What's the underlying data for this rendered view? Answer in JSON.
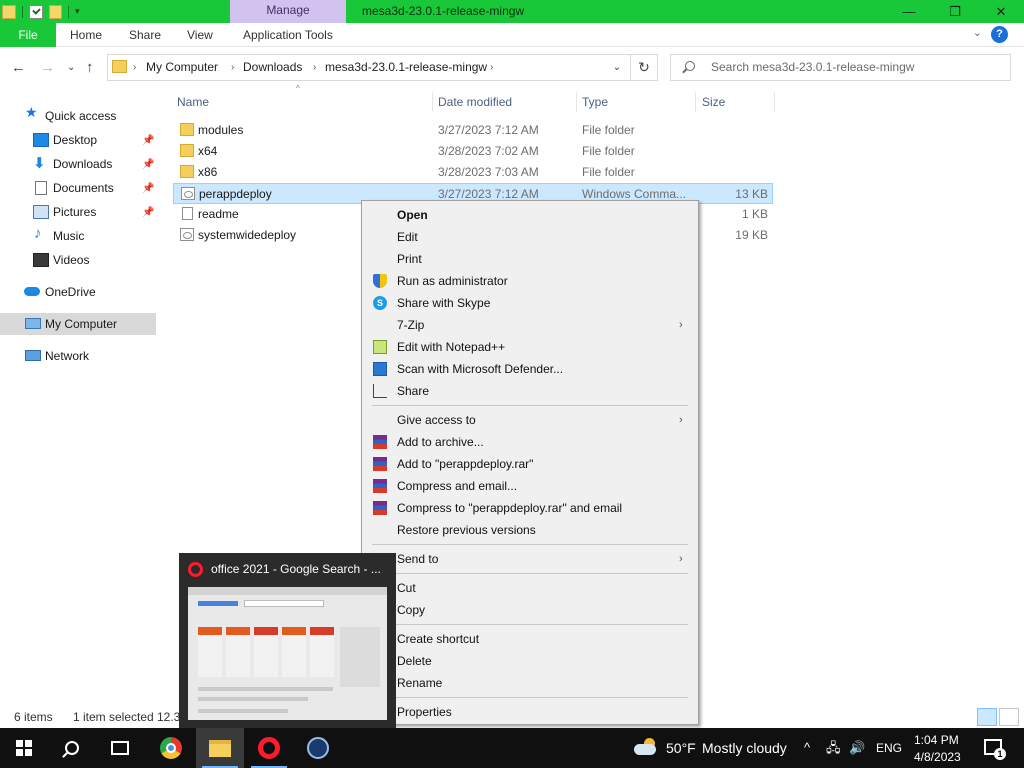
{
  "titlebar": {
    "manage_tab": "Manage",
    "window_title": "mesa3d-23.0.1-release-mingw",
    "controls": [
      "—",
      "❐",
      "✕"
    ]
  },
  "ribbon": {
    "tabs": [
      "File",
      "Home",
      "Share",
      "View",
      "Application Tools"
    ],
    "help": "?",
    "expand": "⌄"
  },
  "nav": {
    "back": "←",
    "forward": "→",
    "recent": "⌄",
    "up": "↑",
    "breadcrumb": [
      "My Computer",
      "Downloads",
      "mesa3d-23.0.1-release-mingw"
    ],
    "separator": "›",
    "dropdown": "⌄",
    "refresh": "↻",
    "search_placeholder": "Search mesa3d-23.0.1-release-mingw"
  },
  "sidebar": {
    "items": [
      {
        "label": "Quick access",
        "icon": "star-icon",
        "pinned": false
      },
      {
        "label": "Desktop",
        "icon": "desktop-icon",
        "pinned": true
      },
      {
        "label": "Downloads",
        "icon": "download-icon",
        "pinned": true
      },
      {
        "label": "Documents",
        "icon": "documents-icon",
        "pinned": true
      },
      {
        "label": "Pictures",
        "icon": "pictures-icon",
        "pinned": true
      },
      {
        "label": "Music",
        "icon": "music-icon",
        "pinned": false
      },
      {
        "label": "Videos",
        "icon": "videos-icon",
        "pinned": false
      },
      {
        "label": "OneDrive",
        "icon": "cloud-icon",
        "pinned": false
      },
      {
        "label": "My Computer",
        "icon": "computer-icon",
        "pinned": false
      },
      {
        "label": "Network",
        "icon": "network-icon",
        "pinned": false
      }
    ],
    "pin_glyph": "📌"
  },
  "filelist": {
    "columns": [
      "Name",
      "Date modified",
      "Type",
      "Size"
    ],
    "sort_glyph": "^",
    "rows": [
      {
        "name": "modules",
        "date": "3/27/2023 7:12 AM",
        "type": "File folder",
        "size": "",
        "kind": "folder"
      },
      {
        "name": "x64",
        "date": "3/28/2023 7:02 AM",
        "type": "File folder",
        "size": "",
        "kind": "folder"
      },
      {
        "name": "x86",
        "date": "3/28/2023 7:03 AM",
        "type": "File folder",
        "size": "",
        "kind": "folder"
      },
      {
        "name": "perappdeploy",
        "date": "3/27/2023 7:12 AM",
        "type": "Windows Comma...",
        "size": "13 KB",
        "kind": "cmd"
      },
      {
        "name": "readme",
        "date": "",
        "type": "",
        "size": "1 KB",
        "kind": "txt"
      },
      {
        "name": "systemwidedeploy",
        "date": "",
        "type": "",
        "size": "19 KB",
        "kind": "cmd"
      }
    ]
  },
  "context_menu": {
    "groups": [
      [
        {
          "label": "Open",
          "bold": true,
          "icon": ""
        },
        {
          "label": "Edit",
          "icon": ""
        },
        {
          "label": "Print",
          "icon": ""
        },
        {
          "label": "Run as administrator",
          "icon": "shield-icon"
        },
        {
          "label": "Share with Skype",
          "icon": "skype-icon"
        },
        {
          "label": "7-Zip",
          "icon": "",
          "submenu": true
        },
        {
          "label": "Edit with Notepad++",
          "icon": "notepadpp-icon"
        },
        {
          "label": "Scan with Microsoft Defender...",
          "icon": "defender-icon"
        },
        {
          "label": "Share",
          "icon": "share-icon"
        }
      ],
      [
        {
          "label": "Give access to",
          "icon": "",
          "submenu": true
        },
        {
          "label": "Add to archive...",
          "icon": "winrar-icon"
        },
        {
          "label": "Add to \"perappdeploy.rar\"",
          "icon": "winrar-icon"
        },
        {
          "label": "Compress and email...",
          "icon": "winrar-icon"
        },
        {
          "label": "Compress to \"perappdeploy.rar\" and email",
          "icon": "winrar-icon"
        },
        {
          "label": "Restore previous versions",
          "icon": ""
        }
      ],
      [
        {
          "label": "Send to",
          "icon": "",
          "submenu": true
        }
      ],
      [
        {
          "label": "Cut",
          "icon": ""
        },
        {
          "label": "Copy",
          "icon": ""
        }
      ],
      [
        {
          "label": "Create shortcut",
          "icon": ""
        },
        {
          "label": "Delete",
          "icon": ""
        },
        {
          "label": "Rename",
          "icon": ""
        }
      ],
      [
        {
          "label": "Properties",
          "icon": ""
        }
      ]
    ],
    "submenu_glyph": "›"
  },
  "status": {
    "items_count": "6 items",
    "selected": "1 item selected",
    "selected_size": "12.3"
  },
  "preview": {
    "title": "office 2021 - Google Search - ..."
  },
  "taskbar": {
    "weather_temp": "50°F",
    "weather_text": "Mostly cloudy",
    "tray_up": "^",
    "network_glyph": "🖧",
    "volume_glyph": "🔊",
    "language": "ENG",
    "time": "1:04 PM",
    "date": "4/8/2023",
    "notification_count": "1"
  }
}
